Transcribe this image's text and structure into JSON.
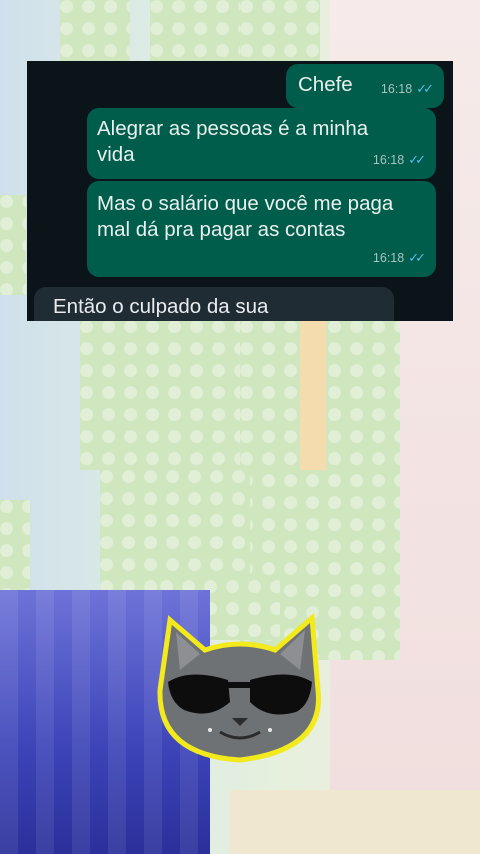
{
  "messages": [
    {
      "text": "Chefe",
      "time": "16:18",
      "status": "read"
    },
    {
      "text": "Alegrar as pessoas é a minha vida",
      "time": "16:18",
      "status": "read"
    },
    {
      "text": "Mas o salário que você me paga mal dá pra pagar as contas",
      "time": "16:18",
      "status": "read"
    },
    {
      "text": "Então o culpado da sua"
    }
  ],
  "colors": {
    "chat_bg": "#0b1418",
    "outgoing_bubble": "#005c4b",
    "incoming_bubble": "#1f2c33",
    "read_ticks": "#53bdeb"
  },
  "icons": {
    "read_receipt": "double-check-icon",
    "sticker": "cool-cat-sunglasses-sticker"
  }
}
